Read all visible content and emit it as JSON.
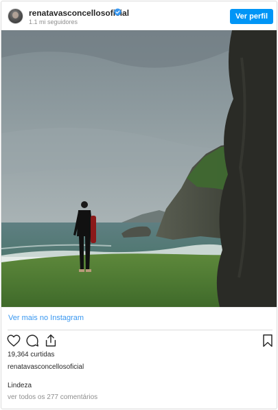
{
  "header": {
    "username": "renatavasconcellosoficial",
    "followers": "1.1 mi seguidores",
    "profile_button": "Ver perfil",
    "verified_icon": "verified-badge-icon"
  },
  "post": {
    "photo_description_icon": "post-photo",
    "more_link": "Ver mais no Instagram"
  },
  "actions": {
    "icons": [
      "heart-icon",
      "comment-icon",
      "share-icon",
      "bookmark-icon"
    ]
  },
  "stats": {
    "likes": "19,364 curtidas",
    "liked_by": "renatavasconcellosoficial"
  },
  "caption": {
    "text": "Lindeza",
    "comments_link": "ver todos os 277 comentários"
  },
  "colors": {
    "accent": "#0095f6",
    "link": "#3897f0",
    "muted": "#8e8e8e"
  }
}
